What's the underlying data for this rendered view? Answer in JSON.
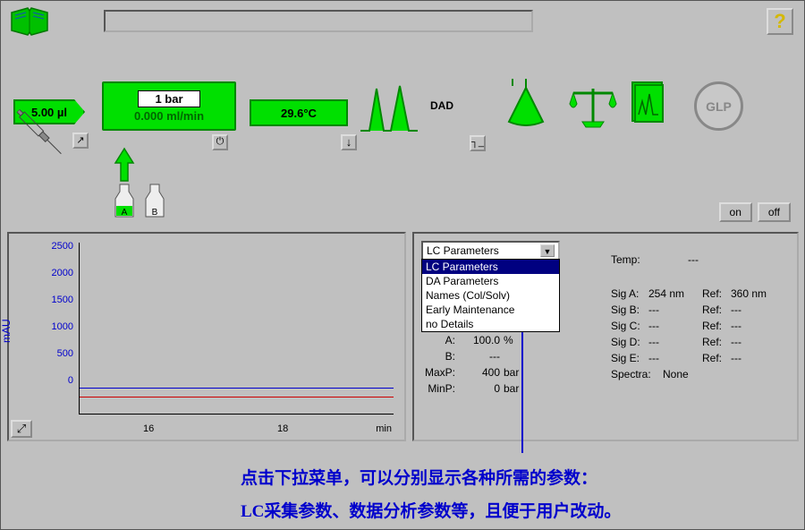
{
  "toolbar": {
    "help": "?",
    "on_label": "on",
    "off_label": "off"
  },
  "modules": {
    "injection_volume": "5.00 µl",
    "pump_pressure": "1 bar",
    "pump_flow": "0.000 ml/min",
    "column_temp": "29.6°C",
    "detector_label": "DAD",
    "glp_label": "GLP",
    "bottle_a": "A",
    "bottle_b": "B"
  },
  "dropdown": {
    "selected": "LC Parameters",
    "items": [
      "LC Parameters",
      "DA Parameters",
      "Names (Col/Solv)",
      "Early Maintenance",
      "no Details"
    ]
  },
  "params_left": {
    "a": {
      "label": "A:",
      "value": "100.0",
      "unit": "%"
    },
    "b": {
      "label": "B:",
      "value": "---",
      "unit": ""
    },
    "maxp": {
      "label": "MaxP:",
      "value": "400",
      "unit": "bar"
    },
    "minp": {
      "label": "MinP:",
      "value": "0",
      "unit": "bar"
    }
  },
  "params_right": {
    "temp": {
      "label": "Temp:",
      "value": "---"
    },
    "siga": {
      "label": "Sig A:",
      "value": "254 nm",
      "ref_label": "Ref:",
      "ref": "360 nm"
    },
    "sigb": {
      "label": "Sig B:",
      "value": "---",
      "ref_label": "Ref:",
      "ref": "---"
    },
    "sigc": {
      "label": "Sig C:",
      "value": "---",
      "ref_label": "Ref:",
      "ref": "---"
    },
    "sigd": {
      "label": "Sig D:",
      "value": "---",
      "ref_label": "Ref:",
      "ref": "---"
    },
    "sige": {
      "label": "Sig E:",
      "value": "---",
      "ref_label": "Ref:",
      "ref": "---"
    },
    "spectra": {
      "label": "Spectra:",
      "value": "None"
    }
  },
  "chart_data": {
    "type": "line",
    "ylabel": "mAU",
    "xlabel": "min",
    "y_ticks": [
      0,
      500,
      1000,
      1500,
      2000,
      2500
    ],
    "x_ticks": [
      16,
      18
    ],
    "ylim": [
      -200,
      2800
    ],
    "series": [
      {
        "name": "signal-blue",
        "color": "#0000cc",
        "x": [
          15,
          16,
          17,
          18,
          19
        ],
        "y": [
          20,
          20,
          20,
          20,
          20
        ]
      },
      {
        "name": "signal-red",
        "color": "#cc0000",
        "x": [
          15,
          16,
          17,
          18,
          19
        ],
        "y": [
          -80,
          -80,
          -80,
          -80,
          -80
        ]
      }
    ]
  },
  "annotations": {
    "line1": "点击下拉菜单，可以分别显示各种所需的参数：",
    "line2": "LC采集参数、数据分析参数等，且便于用户改动。"
  }
}
